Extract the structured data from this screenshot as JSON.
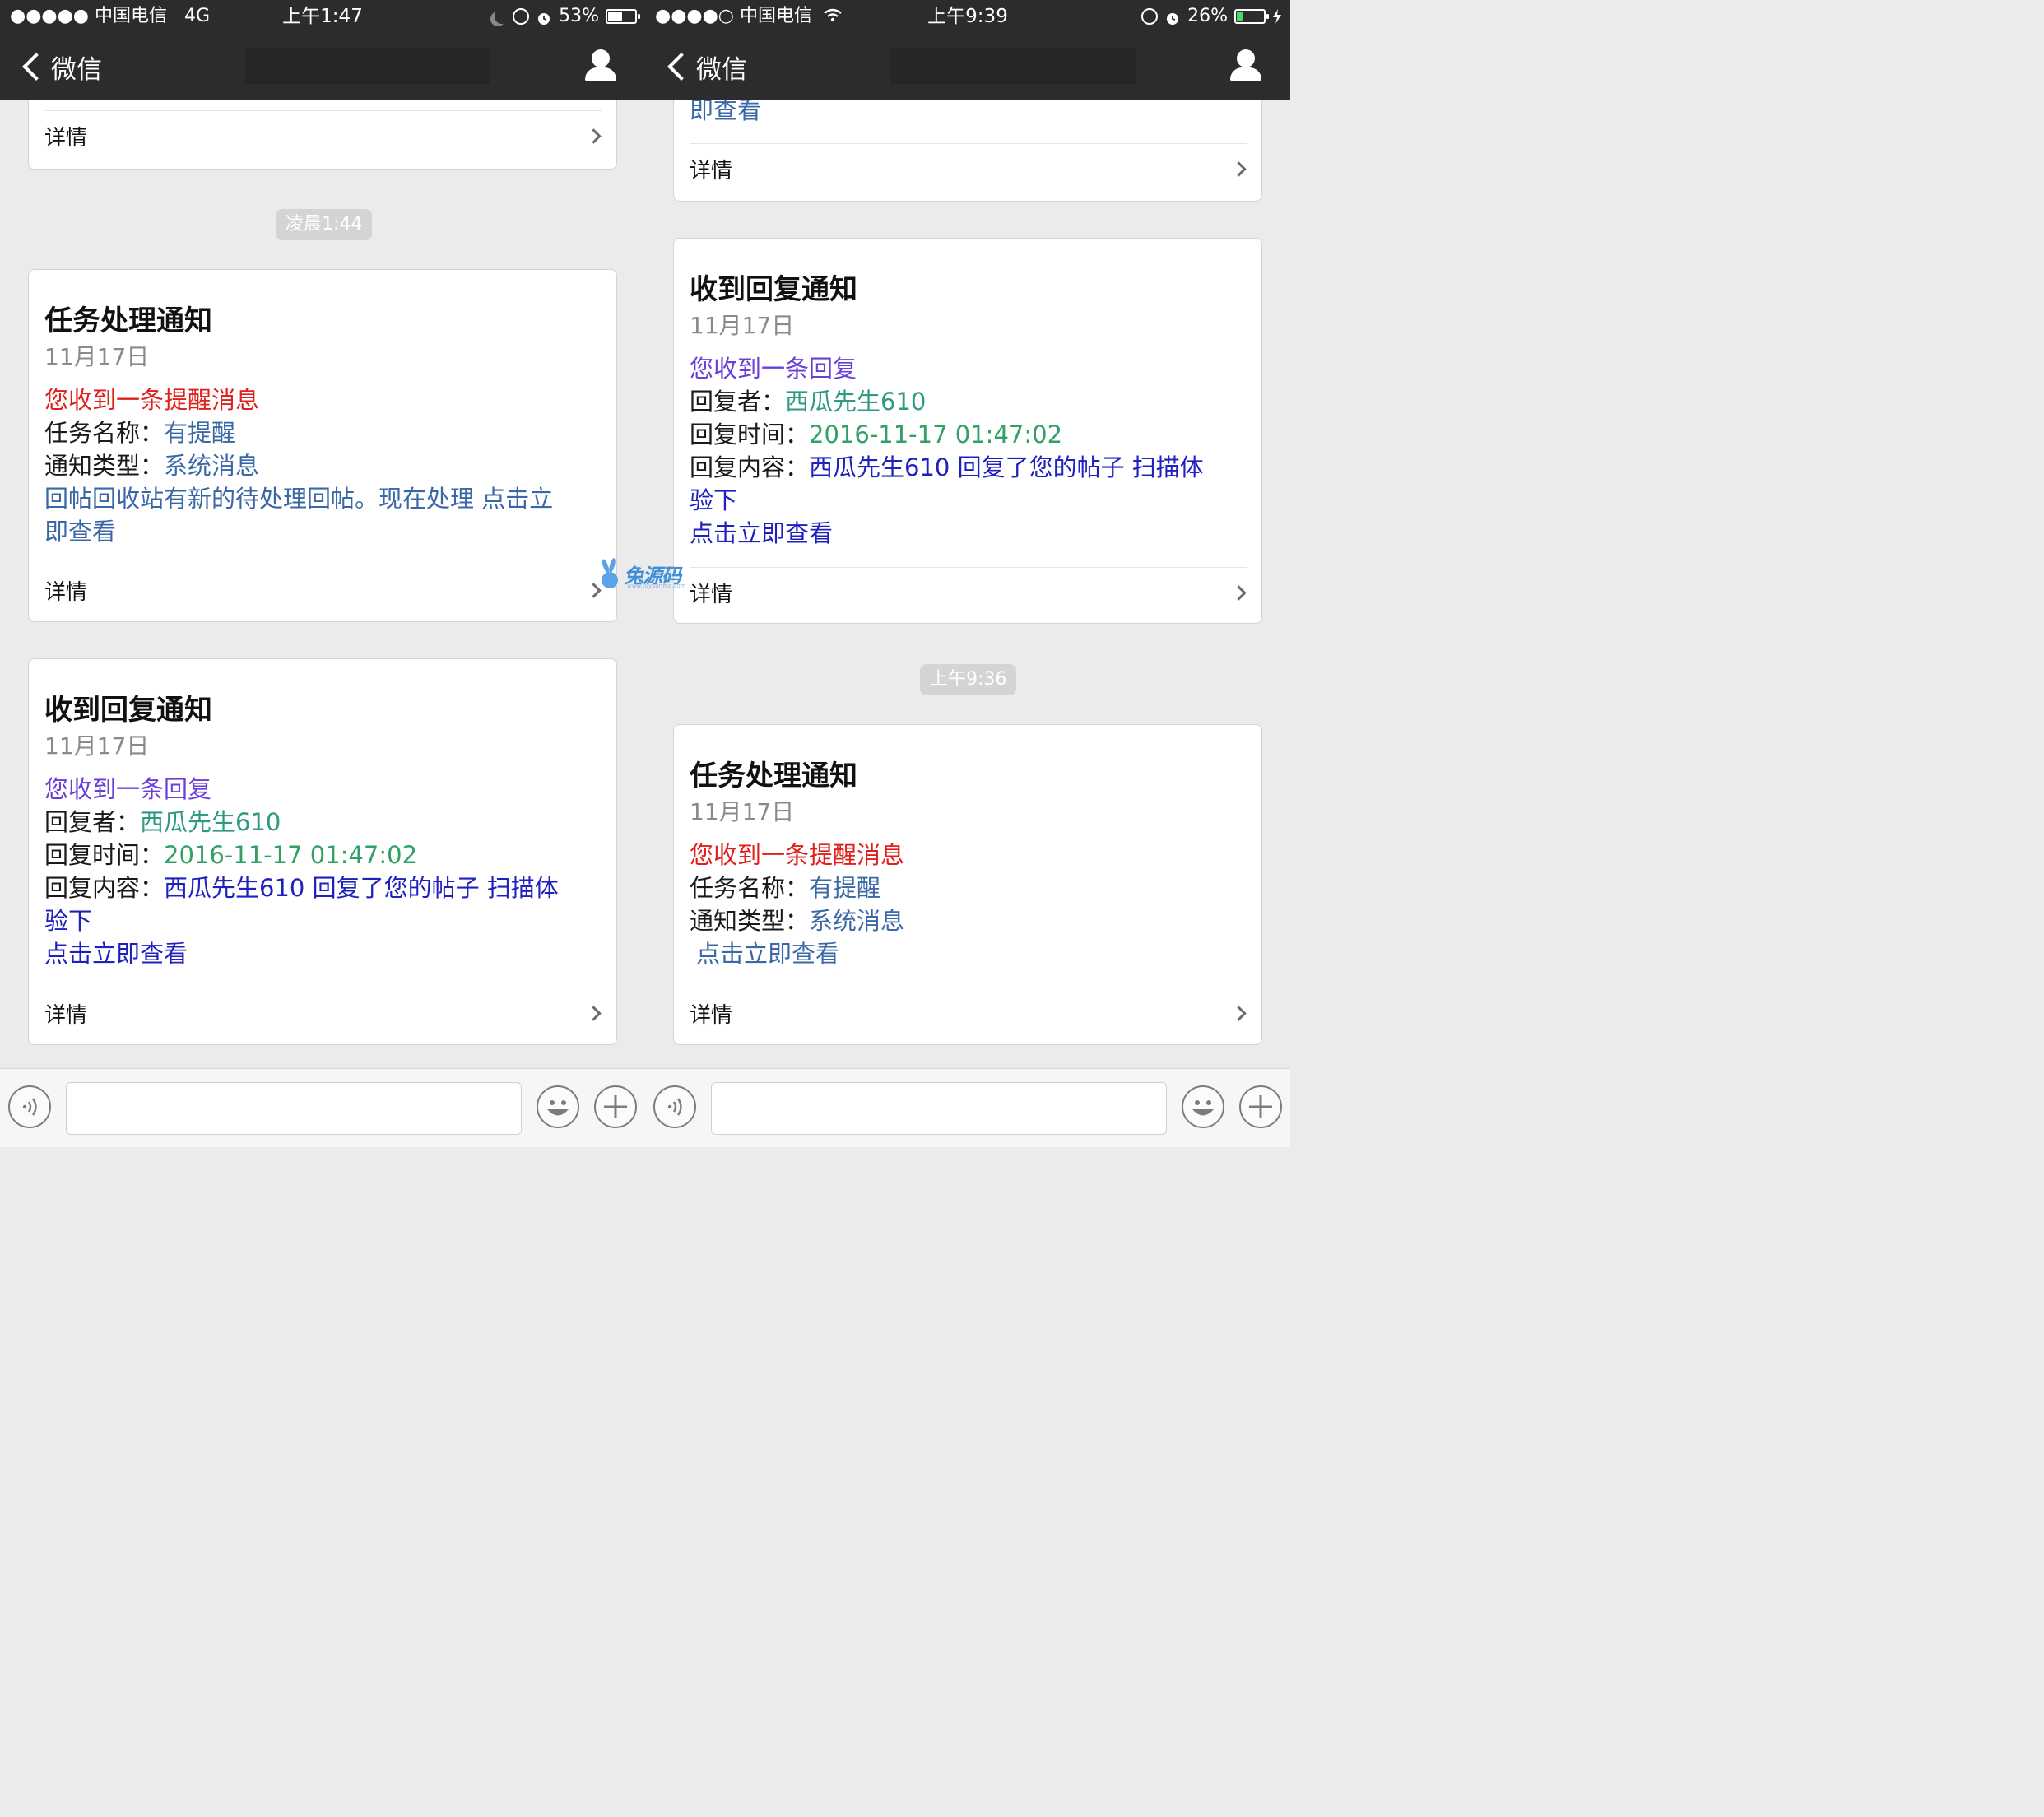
{
  "colors": {
    "red": "#e0201c",
    "blue_value": "#3a68a6",
    "purple": "#6a3fd6",
    "teal": "#2e9a82",
    "green": "#30a064",
    "navy": "#1f21bf",
    "label": "#1a1a1a"
  },
  "phones": {
    "left": {
      "status": {
        "carrier": "●●●●● 中国电信",
        "network": "4G",
        "time": "上午1:47",
        "battery": "53%",
        "battery_level": 0.53
      },
      "nav": {
        "back_label": "微信"
      },
      "details_label": "详情",
      "time_badge": "凌晨1:44",
      "task_card": {
        "title": "任务处理通知",
        "date": "11月17日",
        "intro": "您收到一条提醒消息",
        "name_label": "任务名称：",
        "name_value": "有提醒",
        "type_label": "通知类型：",
        "type_value": "系统消息",
        "remark_line1": "回帖回收站有新的待处理回帖。现在处理 点击立",
        "remark_line2": "即查看"
      },
      "reply_card": {
        "title": "收到回复通知",
        "date": "11月17日",
        "intro": "您收到一条回复",
        "replier_label": "回复者：",
        "replier_value": "西瓜先生610",
        "time_label": "回复时间：",
        "time_value": "2016-11-17 01:47:02",
        "content_label": "回复内容：",
        "content_line1": "西瓜先生610 回复了您的帖子 扫描体",
        "content_line2": "验下",
        "link": "点击立即查看"
      }
    },
    "right": {
      "status": {
        "carrier": "●●●●○ 中国电信",
        "time": "上午9:39",
        "battery": "26%",
        "battery_level": 0.26
      },
      "nav": {
        "back_label": "微信"
      },
      "details_label": "详情",
      "top_partial": "即查看",
      "time_badge": "上午9:36",
      "reply_card": {
        "title": "收到回复通知",
        "date": "11月17日",
        "intro": "您收到一条回复",
        "replier_label": "回复者：",
        "replier_value": "西瓜先生610",
        "time_label": "回复时间：",
        "time_value": "2016-11-17 01:47:02",
        "content_label": "回复内容：",
        "content_line1": "西瓜先生610 回复了您的帖子 扫描体",
        "content_line2": "验下",
        "link": "点击立即查看"
      },
      "task_card": {
        "title": "任务处理通知",
        "date": "11月17日",
        "intro": "您收到一条提醒消息",
        "name_label": "任务名称：",
        "name_value": "有提醒",
        "type_label": "通知类型：",
        "type_value": "系统消息",
        "link": "点击立即查看"
      }
    }
  },
  "watermark": {
    "brand": "兔源码",
    "url": "www.tuyuanma.com"
  },
  "icons": [
    "chevron-left-icon",
    "person-icon",
    "chevron-right-icon",
    "voice-icon",
    "emoji-icon",
    "plus-icon",
    "moon-icon",
    "alarm-icon",
    "rotation-lock-icon",
    "wifi-icon",
    "charging-icon",
    "battery-icon"
  ]
}
